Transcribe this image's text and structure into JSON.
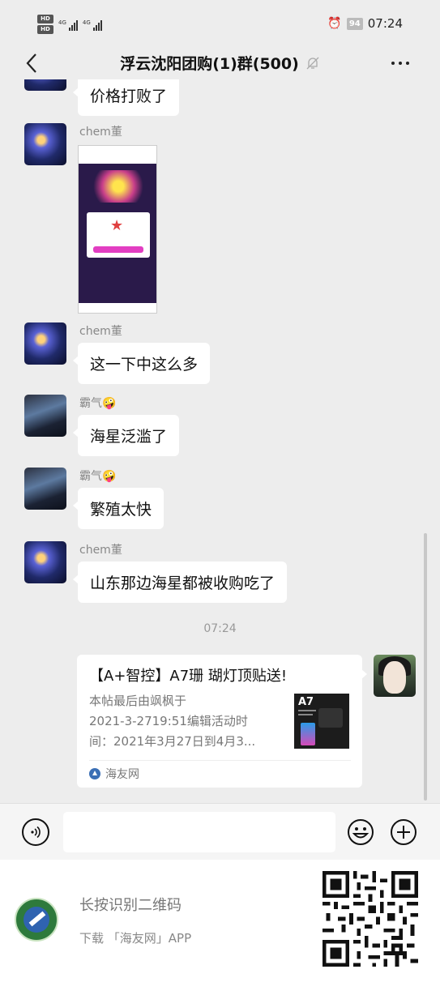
{
  "status_bar": {
    "hd_label_1": "HD",
    "hd_label_2": "HD",
    "signal_1_label": "4G",
    "signal_2_label": "4G",
    "battery": "94",
    "time": "07:24",
    "alarm_icon": "alarm-clock-icon"
  },
  "header": {
    "title": "浮云沈阳团购(1)群(500)",
    "back_icon": "back-chevron-icon",
    "mute_icon": "bell-muted-icon",
    "more_icon": "more-dots-icon"
  },
  "messages": [
    {
      "type": "text",
      "sender": "",
      "text": "价格打败了"
    },
    {
      "type": "image",
      "sender": "chem董",
      "image": "screenshot-thumbnail"
    },
    {
      "type": "text",
      "sender": "chem董",
      "text": "这一下中这么多"
    },
    {
      "type": "text",
      "sender": "霸气🤪",
      "text": "海星泛滥了"
    },
    {
      "type": "text",
      "sender": "霸气🤪",
      "text": "繁殖太快"
    },
    {
      "type": "text",
      "sender": "chem董",
      "text": "山东那边海星都被收购吃了"
    }
  ],
  "timestamp": "07:24",
  "link_card": {
    "title": "【A+智控】A7珊 瑚灯顶贴送!",
    "desc_lines": [
      "本帖最后由飒枫于",
      "2021-3-2719:51编辑活动时",
      "间：2021年3月27日到4月3..."
    ],
    "thumb_label": "A7",
    "source": "海友网"
  },
  "input_bar": {
    "voice_icon": "voice-icon",
    "emoji_icon": "emoji-icon",
    "plus_icon": "plus-icon",
    "text_value": ""
  },
  "footer": {
    "main": "长按识别二维码",
    "sub": "下载 「海友网」APP"
  },
  "colors": {
    "background": "#ededed",
    "bubble": "#ffffff",
    "accent_blue": "#2f63b0"
  }
}
